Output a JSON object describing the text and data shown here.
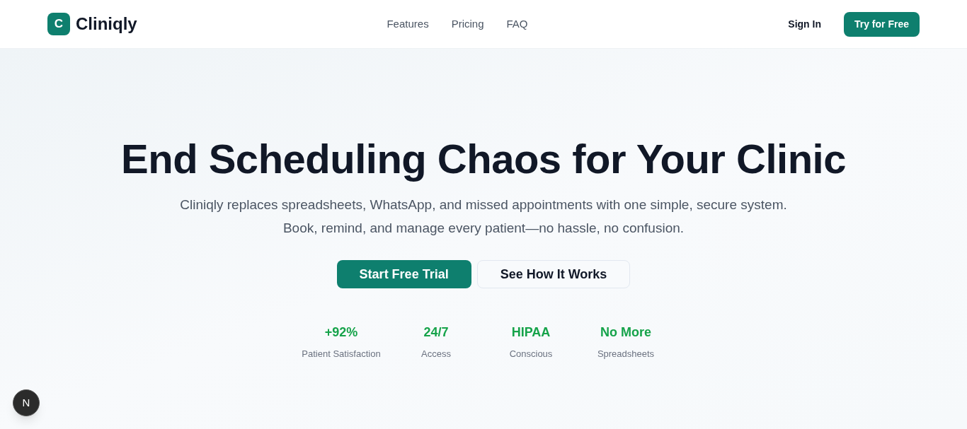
{
  "header": {
    "logo": {
      "mark": "C",
      "name": "Cliniqly"
    },
    "nav_links": [
      "Features",
      "Pricing",
      "FAQ"
    ],
    "sign_in": "Sign In",
    "cta": "Try for Free"
  },
  "hero": {
    "title": "End Scheduling Chaos for Your Clinic",
    "subtitle": "Cliniqly replaces spreadsheets, WhatsApp, and missed appointments with one simple, secure system. Book, remind, and manage every patient—no hassle, no confusion.",
    "buttons": [
      {
        "label": "Start Free Trial",
        "kind": "primary"
      },
      {
        "label": "See How It Works",
        "kind": "secondary"
      }
    ],
    "stats": [
      {
        "value": "+92%",
        "label": "Patient Satisfaction"
      },
      {
        "value": "24/7",
        "label": "Access"
      },
      {
        "value": "HIPAA",
        "label": "Conscious"
      },
      {
        "value": "No More",
        "label": "Spreadsheets"
      }
    ]
  },
  "dev_indicator": {
    "label": "N"
  }
}
